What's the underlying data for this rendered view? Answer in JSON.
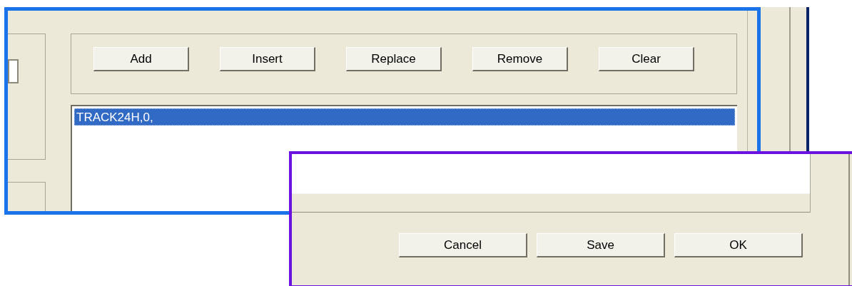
{
  "upper_panel": {
    "buttons": [
      {
        "label": "Add"
      },
      {
        "label": "Insert"
      },
      {
        "label": "Replace"
      },
      {
        "label": "Remove"
      },
      {
        "label": "Clear"
      }
    ],
    "list": {
      "items": [
        {
          "text": "TRACK24H,0,",
          "selected": true
        }
      ]
    }
  },
  "lower_panel": {
    "buttons": [
      {
        "label": "Cancel"
      },
      {
        "label": "Save"
      },
      {
        "label": "OK"
      }
    ]
  }
}
